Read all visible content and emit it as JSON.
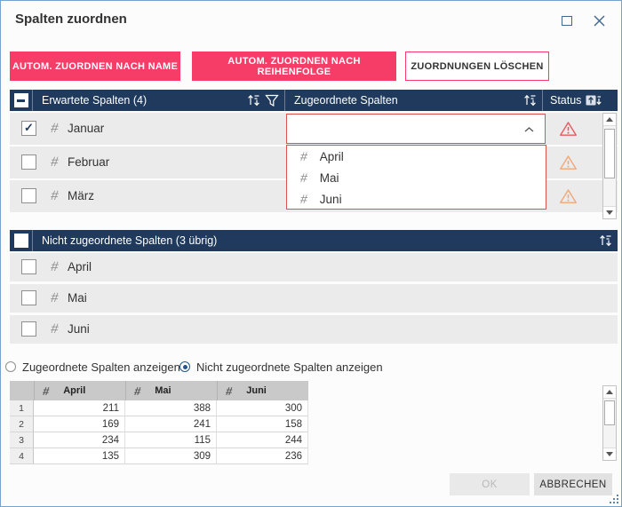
{
  "window": {
    "title": "Spalten zuordnen"
  },
  "toolbar": {
    "auto_by_name": "AUTOM. ZUORDNEN NACH NAME",
    "auto_by_order": "AUTOM. ZUORDNEN NACH REIHENFOLGE",
    "clear_mappings": "ZUORDNUNGEN LÖSCHEN"
  },
  "mapping_table": {
    "select_all_state": "indeterminate",
    "expected_header": "Erwartete Spalten (4)",
    "mapped_header": "Zugeordnete Spalten",
    "status_header": "Status",
    "rows": [
      {
        "type_icon": "number",
        "name": "Januar",
        "checked": true,
        "status": "error"
      },
      {
        "type_icon": "number",
        "name": "Februar",
        "checked": false,
        "status": "warning"
      },
      {
        "type_icon": "number",
        "name": "März",
        "checked": false,
        "status": "warning"
      }
    ],
    "open_dropdown": {
      "row": "Januar",
      "value": "",
      "options": [
        {
          "type_icon": "number",
          "label": "April"
        },
        {
          "type_icon": "number",
          "label": "Mai"
        },
        {
          "type_icon": "number",
          "label": "Juni"
        }
      ]
    }
  },
  "unmapped_table": {
    "header": "Nicht zugeordnete Spalten (3 übrig)",
    "select_all_checked": false,
    "rows": [
      {
        "type_icon": "number",
        "label": "April"
      },
      {
        "type_icon": "number",
        "label": "Mai"
      },
      {
        "type_icon": "number",
        "label": "Juni"
      }
    ]
  },
  "preview": {
    "radios": [
      {
        "label": "Zugeordnete Spalten anzeigen",
        "selected": false
      },
      {
        "label": "Nicht zugeordnete Spalten anzeigen",
        "selected": true
      }
    ],
    "table": {
      "columns": [
        {
          "type_icon": "number",
          "label": "April"
        },
        {
          "type_icon": "number",
          "label": "Mai"
        },
        {
          "type_icon": "number",
          "label": "Juni"
        }
      ],
      "rows": [
        {
          "num": "1",
          "values": [
            "211",
            "388",
            "300"
          ]
        },
        {
          "num": "2",
          "values": [
            "169",
            "241",
            "158"
          ]
        },
        {
          "num": "3",
          "values": [
            "234",
            "115",
            "244"
          ]
        },
        {
          "num": "4",
          "values": [
            "135",
            "309",
            "236"
          ]
        }
      ]
    }
  },
  "footer": {
    "ok_label": "OK",
    "ok_enabled": false,
    "cancel_label": "ABBRECHEN"
  },
  "colors": {
    "accent_pink": "#F53D68",
    "header_navy": "#1F3A5C",
    "error_red": "#E8595F",
    "warning_orange": "#F1A777",
    "dropdown_border_red": "#D9534F",
    "titlebar_icon_blue": "#41678E"
  }
}
